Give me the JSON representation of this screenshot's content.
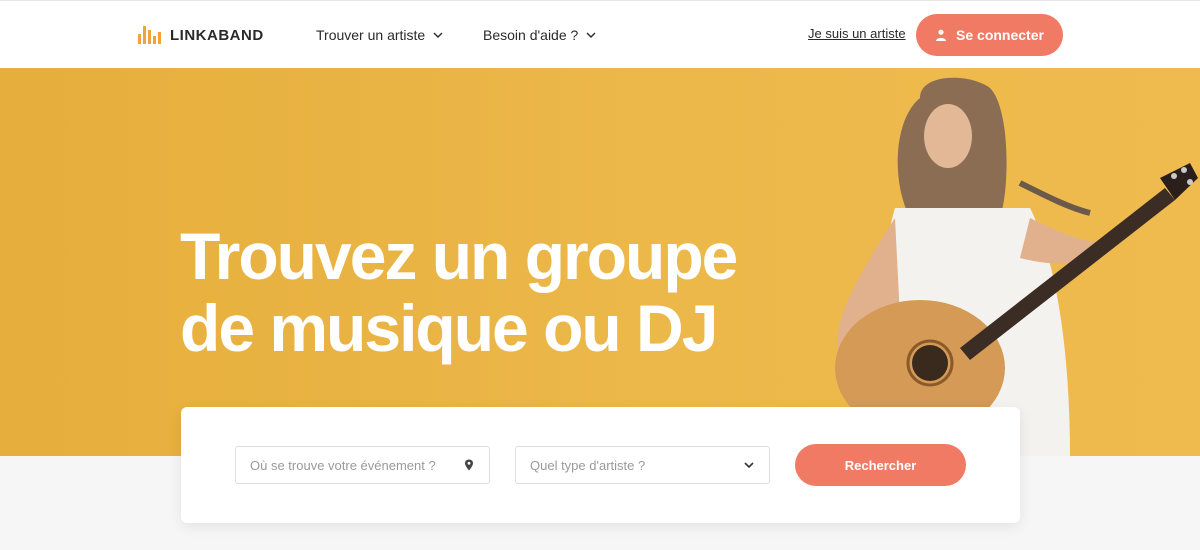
{
  "brand": {
    "name": "LINKABAND",
    "logo_color": "#f2a23a"
  },
  "nav": {
    "find_artist": "Trouver un artiste",
    "help": "Besoin d'aide ?"
  },
  "header": {
    "artist_link": "Je suis un artiste",
    "login": "Se connecter"
  },
  "hero": {
    "title_line1": "Trouvez un groupe",
    "title_line2": "de musique ou DJ",
    "background": "#ecb84a"
  },
  "search": {
    "location_placeholder": "Où se trouve votre événement ?",
    "artist_type_placeholder": "Quel type d'artiste ?",
    "submit": "Rechercher"
  },
  "colors": {
    "accent": "#f07a63",
    "text": "#2a2a2a"
  }
}
